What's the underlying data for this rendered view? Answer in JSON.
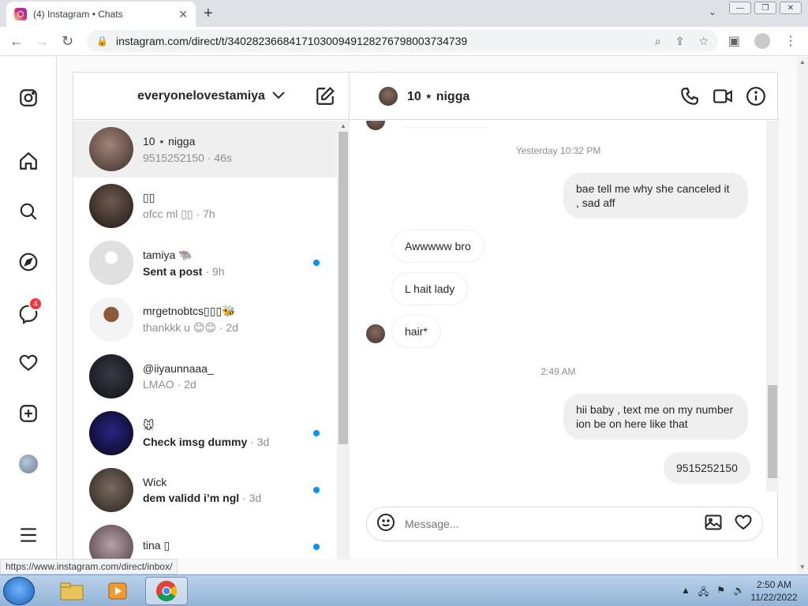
{
  "browser": {
    "tab_title": "(4) Instagram • Chats",
    "url": "instagram.com/direct/t/340282366841710300949128276798003734739",
    "status_url": "https://www.instagram.com/direct/inbox/"
  },
  "nav": {
    "badge_count": "4"
  },
  "inbox": {
    "username": "everyonelovestamiya",
    "threads": [
      {
        "name": "10 ⋆ nigga",
        "preview": "9515252150",
        "time": "· 46s",
        "unread": false,
        "active": true
      },
      {
        "name": "▯▯",
        "preview": "ofcc ml ▯▯",
        "time": "· 7h",
        "unread": false,
        "active": false
      },
      {
        "name": "tamiya 🐃",
        "preview": "Sent a post",
        "time": "· 9h",
        "unread": true,
        "active": false
      },
      {
        "name": "mrgetnobtcs▯▯▯🐝",
        "preview": "thankkk u 😊😊",
        "time": "· 2d",
        "unread": false,
        "active": false
      },
      {
        "name": "@iiyaunnaaa_",
        "preview": "LMAO",
        "time": "· 2d",
        "unread": false,
        "active": false
      },
      {
        "name": "🐭",
        "preview": "Check imsg dummy",
        "time": "· 3d",
        "unread": true,
        "active": false
      },
      {
        "name": "Wick",
        "preview": "dem validd i’m ngl",
        "time": "· 3d",
        "unread": true,
        "active": false
      },
      {
        "name": "tina ▯",
        "preview": "",
        "time": "",
        "unread": true,
        "active": false
      }
    ]
  },
  "chat": {
    "contact_name": "10 ⋆ nigga",
    "stamp1": "Yesterday 10:32 PM",
    "stamp2": "2:49 AM",
    "messages": {
      "m1": "bae tell me why she canceled it , sad aff",
      "m2": "Awwwww bro",
      "m3": "L hait lady",
      "m4": "hair*",
      "m5": "hii baby , text me on my number ion be on here like that",
      "m6": "9515252150"
    },
    "composer_placeholder": "Message..."
  },
  "taskbar": {
    "time": "2:50 AM",
    "date": "11/22/2022"
  },
  "colors": {
    "unread_dot": "#0095f6",
    "badge": "#ff3040"
  }
}
